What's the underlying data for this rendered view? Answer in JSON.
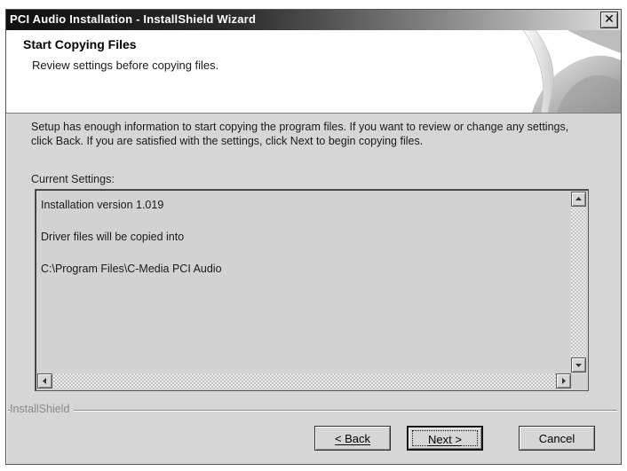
{
  "window": {
    "title": "PCI Audio Installation - InstallShield Wizard",
    "close_icon": "close-icon"
  },
  "header": {
    "title": "Start Copying Files",
    "subtitle": "Review settings before copying files."
  },
  "body": {
    "intro": "Setup has enough information to start copying the program files.  If you want to review or change any settings, click Back.  If you are satisfied with the settings, click Next to begin copying files.",
    "settings_label": "Current Settings:",
    "settings_lines": [
      "Installation version 1.019",
      "Driver files will be copied into",
      "C:\\Program Files\\C-Media PCI Audio"
    ]
  },
  "footer": {
    "brand": "InstallShield",
    "buttons": {
      "back": "< Back",
      "next": "Next >",
      "cancel": "Cancel"
    }
  },
  "colors": {
    "window_bg": "#d6d6d6",
    "header_bg": "#ffffff",
    "titlebar_dark": "#101010"
  }
}
